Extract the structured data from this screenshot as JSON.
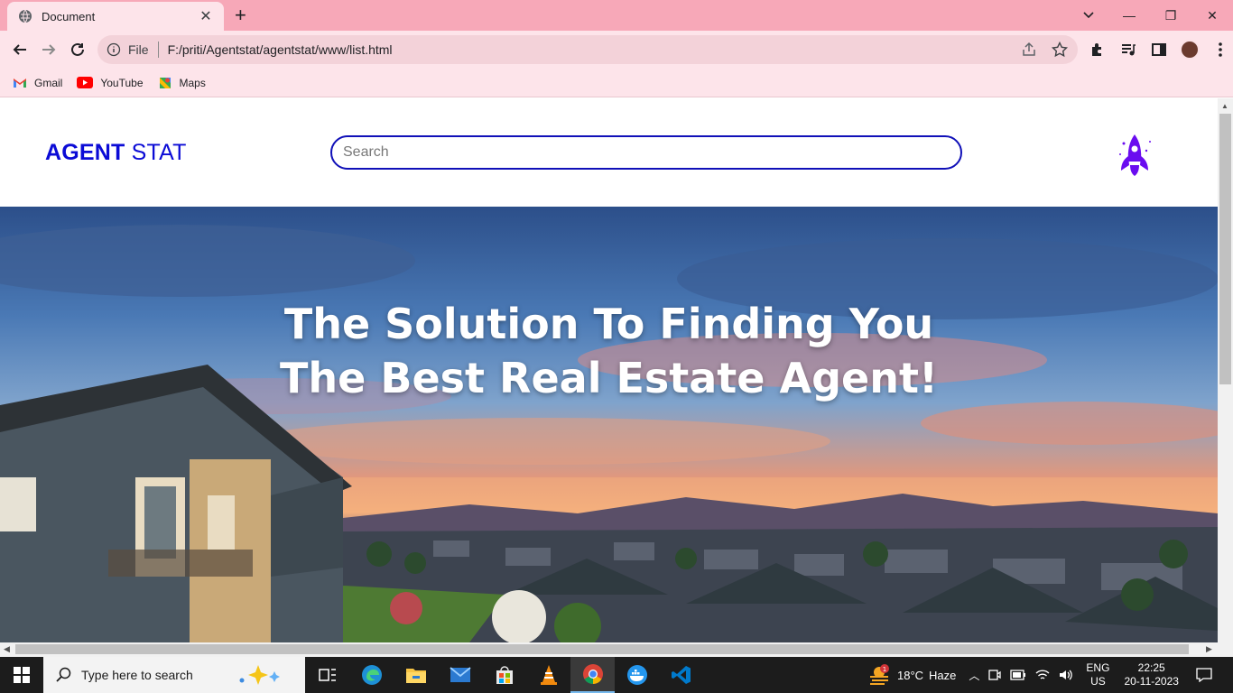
{
  "browser": {
    "tab_title": "Document",
    "address_scheme": "File",
    "address_url": "F:/priti/Agentstat/agentstat/www/list.html",
    "bookmarks": [
      {
        "label": "Gmail",
        "icon": "gmail-icon"
      },
      {
        "label": "YouTube",
        "icon": "youtube-icon"
      },
      {
        "label": "Maps",
        "icon": "maps-icon"
      }
    ]
  },
  "site": {
    "logo_bold": "AGENT",
    "logo_regular": " STAT",
    "search_placeholder": "Search",
    "hero_line1": "The Solution To Finding You",
    "hero_line2": "The Best Real Estate Agent!",
    "brand_color": "#0b0bd6",
    "rocket_color": "#6a0cf0"
  },
  "taskbar": {
    "search_placeholder": "Type here to search",
    "weather_temp": "18°C",
    "weather_desc": "Haze",
    "weather_badge": "1",
    "lang_line1": "ENG",
    "lang_line2": "US",
    "time": "22:25",
    "date": "20-11-2023"
  }
}
